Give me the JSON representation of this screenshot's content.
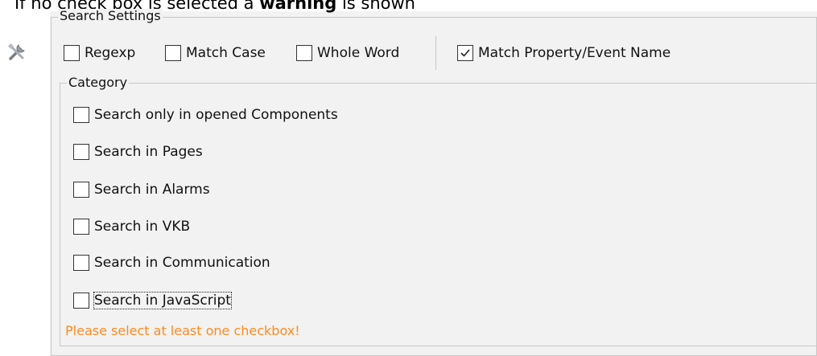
{
  "top_caption": {
    "text_a": "If no check box is selected a ",
    "text_bold": "warning",
    "text_b": " is shown"
  },
  "icons": {
    "tool": "tools-icon"
  },
  "search_settings": {
    "legend": "Search Settings",
    "options": [
      {
        "label": "Regexp",
        "checked": false
      },
      {
        "label": "Match Case",
        "checked": false
      },
      {
        "label": "Whole Word",
        "checked": false
      },
      {
        "label": "Match Property/Event Name",
        "checked": true
      }
    ]
  },
  "category": {
    "legend": "Category",
    "options": [
      {
        "label": "Search only in opened Components",
        "checked": false
      },
      {
        "label": "Search in Pages",
        "checked": false
      },
      {
        "label": "Search in Alarms",
        "checked": false
      },
      {
        "label": "Search in VKB",
        "checked": false
      },
      {
        "label": "Search in Communication",
        "checked": false
      },
      {
        "label": "Search in JavaScript",
        "checked": false
      }
    ]
  },
  "warning_text": "Please select at least one checkbox!",
  "colors": {
    "warning": "#ff8a1e",
    "border": "#c8c8c8",
    "background": "#f2f2f2"
  }
}
